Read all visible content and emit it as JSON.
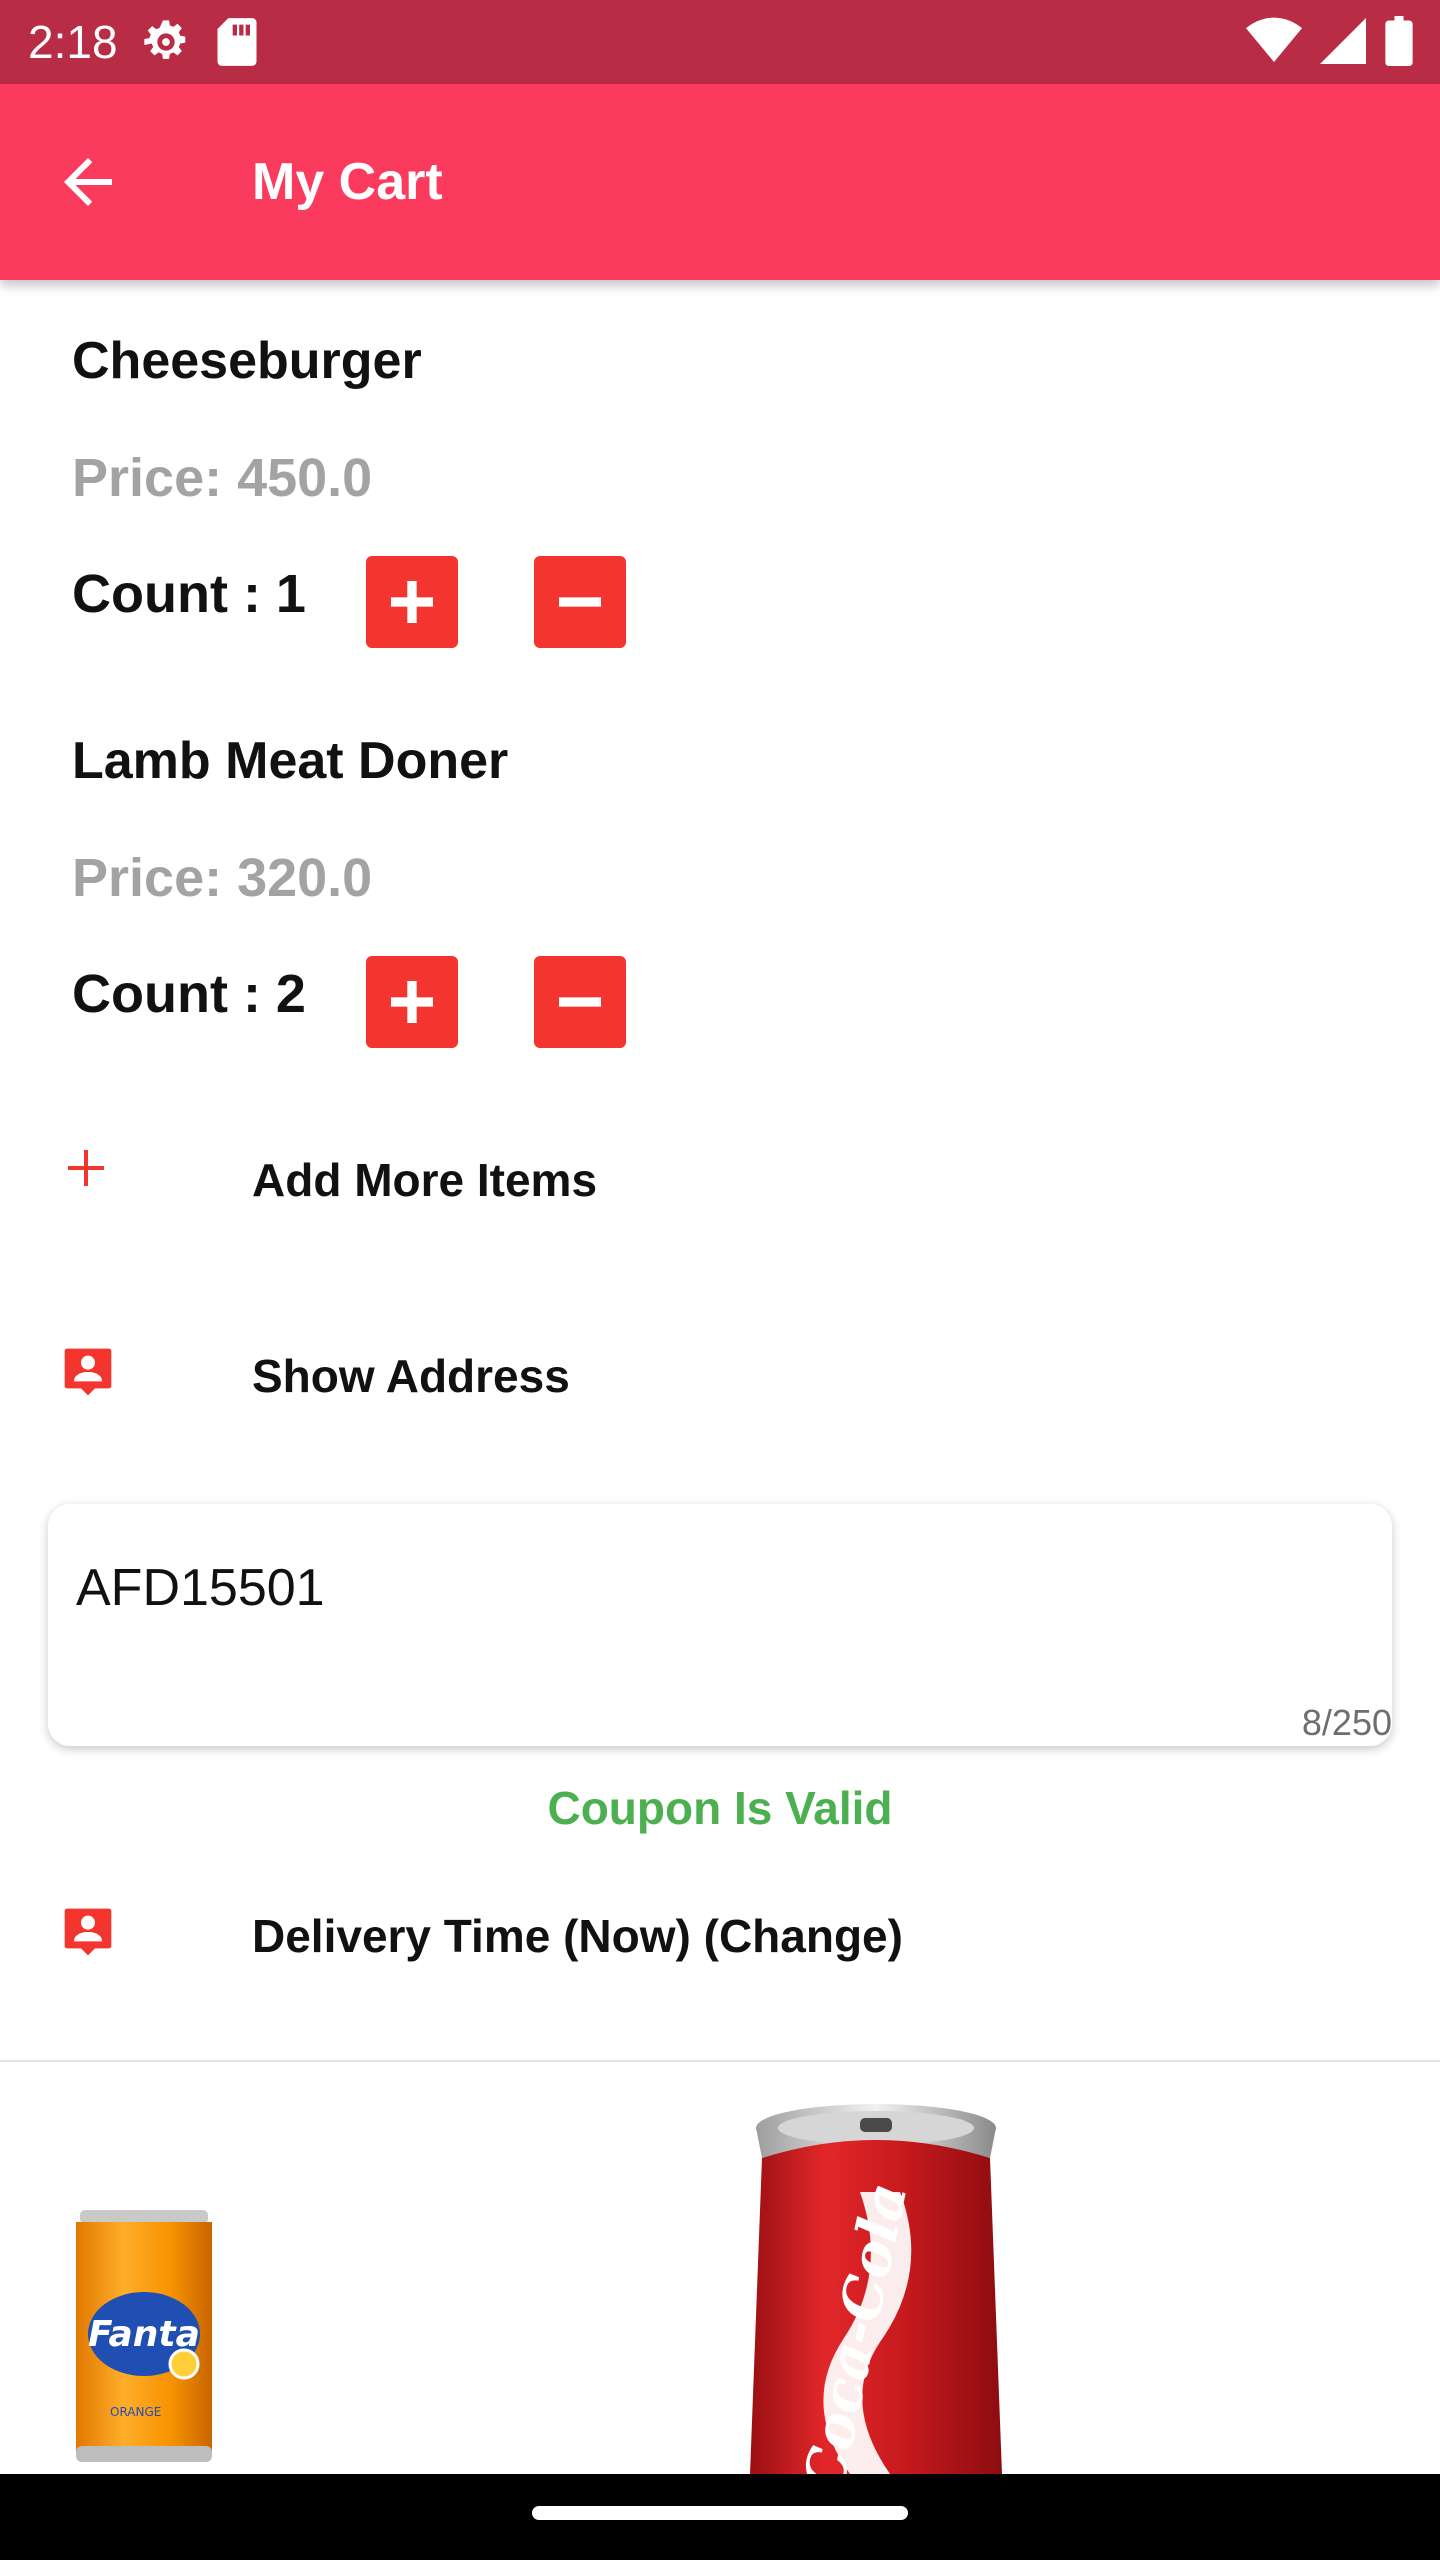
{
  "status_bar": {
    "time": "2:18",
    "left_icons": [
      "settings-icon",
      "sd-card-icon"
    ],
    "right_icons": [
      "wifi-icon",
      "signal-icon",
      "battery-icon"
    ]
  },
  "app_bar": {
    "title": "My Cart",
    "back_icon": "arrow-back-icon",
    "color": "#fb3b5d"
  },
  "cart": {
    "items": [
      {
        "name": "Cheeseburger",
        "price": "Price: 450.0",
        "count": "Count :  1"
      },
      {
        "name": "Lamb Meat Doner",
        "price": "Price: 320.0",
        "count": "Count :  2"
      }
    ]
  },
  "actions": {
    "add_more": "Add More Items",
    "show_address": "Show Address",
    "delivery_time": "Delivery Time (Now) (Change)"
  },
  "coupon": {
    "value": "AFD15501",
    "counter": "8/250",
    "status": "Coupon Is Valid",
    "status_color": "#4caf50"
  },
  "drinks": [
    {
      "brand": "Fanta",
      "subtitle": "ORANGE"
    },
    {
      "brand": "Coca-Cola"
    }
  ],
  "colors": {
    "accent": "#fb3b5d",
    "status_bar": "#b92c45",
    "button": "#f4352f"
  }
}
